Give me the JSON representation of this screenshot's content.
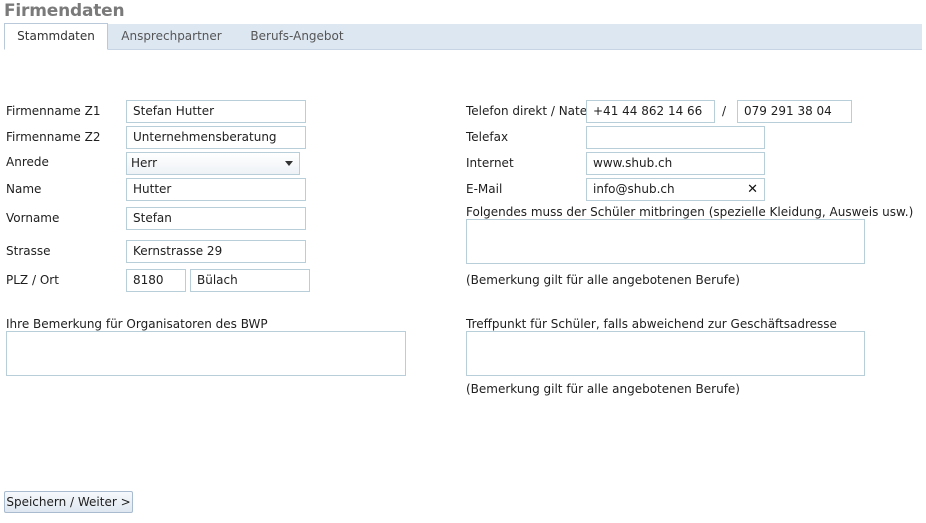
{
  "page": {
    "title": "Firmendaten"
  },
  "tabs": [
    {
      "label": "Stammdaten",
      "active": true
    },
    {
      "label": "Ansprechpartner",
      "active": false
    },
    {
      "label": "Berufs-Angebot",
      "active": false
    }
  ],
  "left_form": {
    "firmenname_z1": {
      "label": "Firmenname Z1",
      "value": "Stefan Hutter"
    },
    "firmenname_z2": {
      "label": "Firmenname Z2",
      "value": "Unternehmensberatung"
    },
    "anrede": {
      "label": "Anrede",
      "value": "Herr"
    },
    "name": {
      "label": "Name",
      "value": "Hutter"
    },
    "vorname": {
      "label": "Vorname",
      "value": "Stefan"
    },
    "strasse": {
      "label": "Strasse",
      "value": "Kernstrasse 29"
    },
    "plz_ort": {
      "label": "PLZ / Ort",
      "plz": "8180",
      "ort": "Bülach"
    },
    "bemerkung_org": {
      "label": "Ihre Bemerkung für Organisatoren des BWP",
      "value": ""
    }
  },
  "right_form": {
    "telefon": {
      "label": "Telefon direkt / Natel",
      "direkt": "+41 44 862 14 66",
      "separator": "/",
      "natel": "079 291 38 04"
    },
    "telefax": {
      "label": "Telefax",
      "value": ""
    },
    "internet": {
      "label": "Internet",
      "value": "www.shub.ch"
    },
    "email": {
      "label": "E-Mail",
      "value": "info@shub.ch",
      "clear_glyph": "✕"
    },
    "mitbringen": {
      "label": "Folgendes muss der Schüler mitbringen (spezielle Kleidung, Ausweis usw.)",
      "value": "",
      "note": "(Bemerkung gilt für alle angebotenen Berufe)"
    },
    "treffpunkt": {
      "label": "Treffpunkt für Schüler, falls abweichend zur Geschäftsadresse",
      "value": "",
      "note": "(Bemerkung gilt für alle angebotenen Berufe)"
    }
  },
  "actions": {
    "save_label": "Speichern / Weiter >"
  }
}
